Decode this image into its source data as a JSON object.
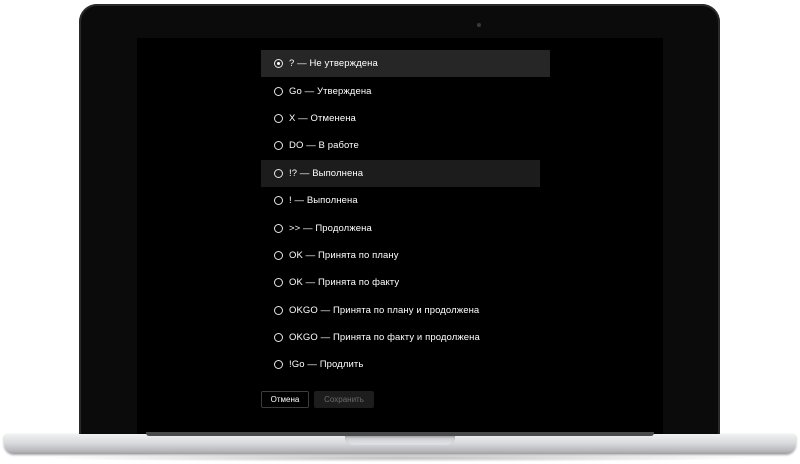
{
  "status_dialog": {
    "options": [
      {
        "label": "? — Не утверждена",
        "selected": true
      },
      {
        "label": "Go — Утверждена",
        "selected": false
      },
      {
        "label": "X — Отменена",
        "selected": false
      },
      {
        "label": "DO — В работе",
        "selected": false
      },
      {
        "label": "!? — Выполнена",
        "selected": false
      },
      {
        "label": "! — Выполнена",
        "selected": false
      },
      {
        "label": ">> — Продолжена",
        "selected": false
      },
      {
        "label": "OK — Принята по плану",
        "selected": false
      },
      {
        "label": "OK — Принята по факту",
        "selected": false
      },
      {
        "label": "OKGO — Принята по плану и продолжена",
        "selected": false
      },
      {
        "label": "OKGO — Принята по факту и продолжена",
        "selected": false
      },
      {
        "label": "!Go — Продлить",
        "selected": false
      }
    ],
    "cancel_label": "Отмена",
    "save_label": "Сохранить",
    "save_enabled": false
  },
  "colors": {
    "screen_background": "#000000",
    "selected_row": "#262626",
    "hover_row": "#1c1c1c",
    "text": "#ffffff",
    "disabled_text": "#6b6b6b"
  }
}
